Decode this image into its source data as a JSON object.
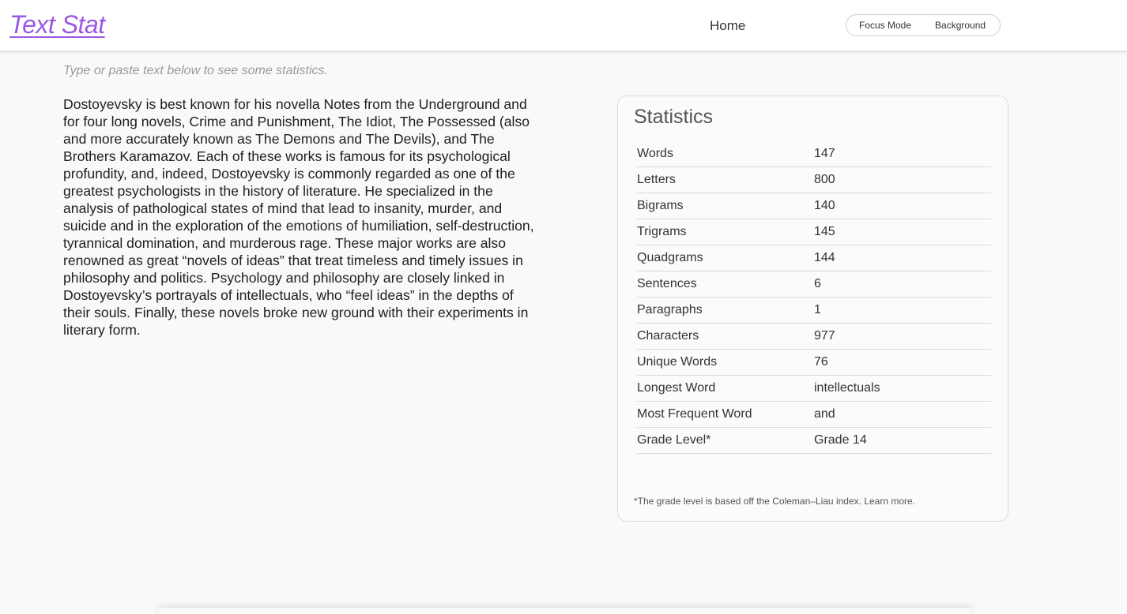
{
  "nav": {
    "brand": "Text Stat",
    "home": "Home",
    "focus_mode": "Focus Mode",
    "background": "Background"
  },
  "editor": {
    "hint": "Type or paste text below to see some statistics.",
    "text": "Dostoyevsky is best known for his novella Notes from the Underground and for four long novels, Crime and Punishment, The Idiot, The Possessed (also and more accurately known as The Demons and The Devils), and The Brothers Karamazov. Each of these works is famous for its psychological profundity, and, indeed, Dostoyevsky is commonly regarded as one of the greatest psychologists in the history of literature. He specialized in the analysis of pathological states of mind that lead to insanity, murder, and suicide and in the exploration of the emotions of humiliation, self-destruction, tyrannical domination, and murderous rage. These major works are also renowned as great “novels of ideas” that treat timeless and timely issues in philosophy and politics. Psychology and philosophy are closely linked in Dostoyevsky’s portrayals of intellectuals, who “feel ideas” in the depths of their souls. Finally, these novels broke new ground with their experiments in literary form."
  },
  "stats": {
    "title": "Statistics",
    "rows": [
      {
        "label": "Words",
        "value": "147"
      },
      {
        "label": "Letters",
        "value": "800"
      },
      {
        "label": "Bigrams",
        "value": "140"
      },
      {
        "label": "Trigrams",
        "value": "145"
      },
      {
        "label": "Quadgrams",
        "value": "144"
      },
      {
        "label": "Sentences",
        "value": "6"
      },
      {
        "label": "Paragraphs",
        "value": "1"
      },
      {
        "label": "Characters",
        "value": "977"
      },
      {
        "label": "Unique Words",
        "value": "76"
      },
      {
        "label": "Longest Word",
        "value": "intellectuals"
      },
      {
        "label": "Most Frequent Word",
        "value": "and"
      },
      {
        "label": "Grade Level*",
        "value": "Grade 14"
      }
    ],
    "footnote": "*The grade level is based off the Coleman–Liau index.",
    "learn_more": "Learn more."
  },
  "colors": {
    "brand": "#9b59e0",
    "background": "#f9f9f9",
    "card_border": "#dcdcdc"
  }
}
